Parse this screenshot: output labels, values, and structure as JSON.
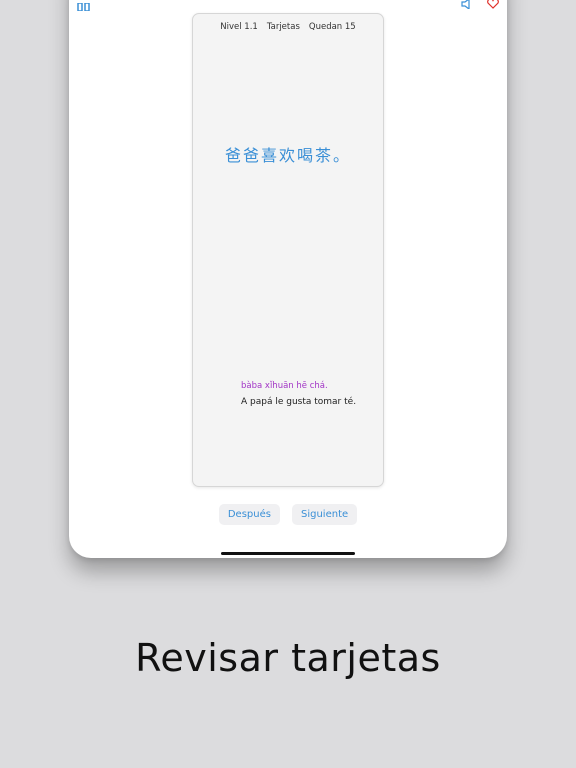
{
  "card": {
    "header": {
      "level": "Nivel 1.1",
      "mode": "Tarjetas",
      "remaining": "Quedan 15"
    },
    "hanzi": "爸爸喜欢喝茶。",
    "pinyin": "bàba xǐhuān hē chá.",
    "translation": "A papá le gusta tomar té."
  },
  "actions": {
    "later_label": "Después",
    "next_label": "Siguiente"
  },
  "caption": "Revisar tarjetas",
  "icons": {
    "top_left": "grid-icon",
    "speaker": "speaker-icon",
    "heart": "heart-icon"
  },
  "colors": {
    "accent": "#3a8fd6",
    "pinyin": "#a235c6",
    "heart": "#e0302a"
  }
}
